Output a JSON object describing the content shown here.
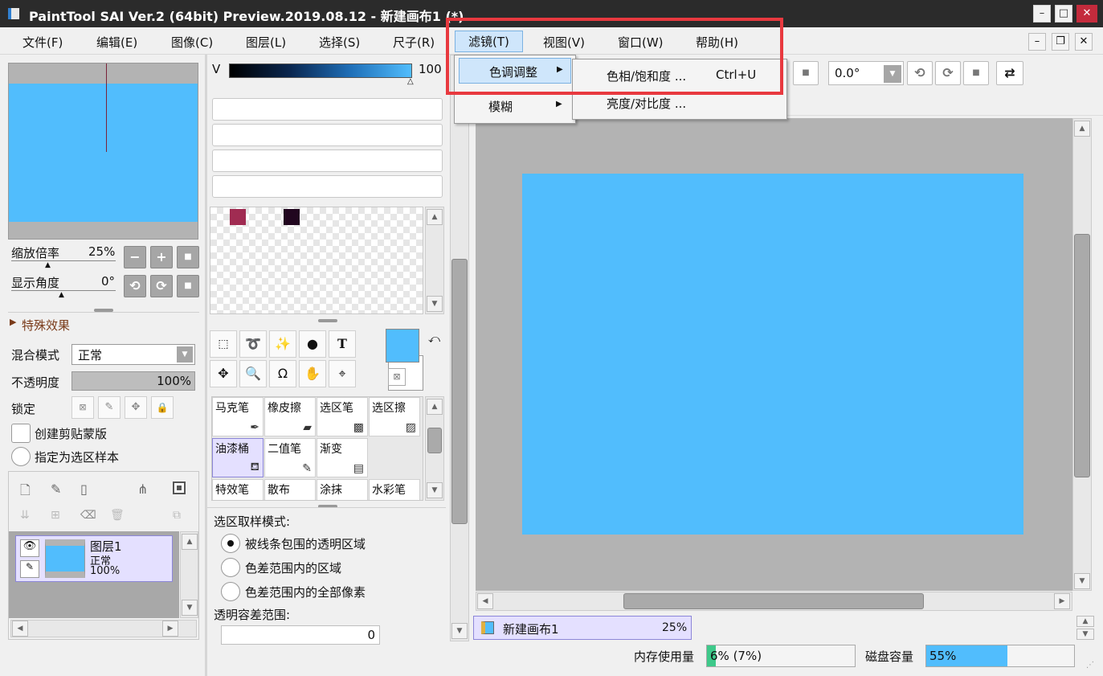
{
  "window": {
    "title": "PaintTool SAI Ver.2 (64bit) Preview.2019.08.12 - 新建画布1 (*)"
  },
  "menubar": {
    "items": [
      "文件(F)",
      "编辑(E)",
      "图像(C)",
      "图层(L)",
      "选择(S)",
      "尺子(R)",
      "滤镜(T)",
      "视图(V)",
      "窗口(W)",
      "帮助(H)"
    ]
  },
  "filter_menu": {
    "items": [
      "色调调整",
      "模糊"
    ]
  },
  "tone_submenu": {
    "items": [
      {
        "label": "色相/饱和度 ...",
        "shortcut": "Ctrl+U"
      },
      {
        "label": "亮度/对比度 ..."
      }
    ]
  },
  "navigator": {
    "zoom_label": "缩放倍率",
    "zoom_value": "25%",
    "angle_label": "显示角度",
    "angle_value": "0°"
  },
  "toolbar": {
    "angle_value": "0.0°"
  },
  "layer_props": {
    "effects_label": "特殊效果",
    "blend_label": "混合模式",
    "blend_value": "正常",
    "opacity_label": "不透明度",
    "opacity_value": "100%",
    "opacity_fraction": 1.0,
    "lock_label": "锁定",
    "clip_label": "创建剪贴蒙版",
    "sample_label": "指定为选区样本"
  },
  "layers": [
    {
      "name": "图层1",
      "mode": "正常",
      "opacity": "100%"
    }
  ],
  "color": {
    "v_label": "V",
    "v_value": "100",
    "v_fraction": 1.0,
    "primary": "#51bdfd",
    "secondary": "#ffffff",
    "swatches": [
      "#a02c52",
      "#21061f"
    ]
  },
  "brushes": [
    {
      "name": "马克笔",
      "icon": "pen-icon"
    },
    {
      "name": "橡皮擦",
      "icon": "eraser-icon"
    },
    {
      "name": "选区笔",
      "icon": "selection-pen-icon"
    },
    {
      "name": "选区擦",
      "icon": "selection-eraser-icon"
    },
    {
      "name": "油漆桶",
      "icon": "bucket-icon"
    },
    {
      "name": "二值笔",
      "icon": "binary-pen-icon"
    },
    {
      "name": "渐变",
      "icon": "gradient-icon"
    },
    {
      "name": "",
      "icon": ""
    },
    {
      "name": "特效笔",
      "icon": ""
    },
    {
      "name": "散布",
      "icon": ""
    },
    {
      "name": "涂抹",
      "icon": ""
    },
    {
      "name": "水彩笔",
      "icon": ""
    }
  ],
  "bucket_options": {
    "mode_label": "选区取样模式:",
    "options": [
      "被线条包围的透明区域",
      "色差范围内的区域",
      "色差范围内的全部像素"
    ],
    "selected": 0,
    "tolerance_label": "透明容差范围:",
    "tolerance_value": "0"
  },
  "canvas": {
    "color": "#51bdfd",
    "background": "#b3b3b3"
  },
  "tabs": [
    {
      "name": "新建画布1",
      "zoom": "25%"
    }
  ],
  "status": {
    "memory_label": "内存使用量",
    "memory_value": "6% (7%)",
    "memory_fraction": 0.06,
    "disk_label": "磁盘容量",
    "disk_value": "55%",
    "disk_fraction": 0.55
  }
}
